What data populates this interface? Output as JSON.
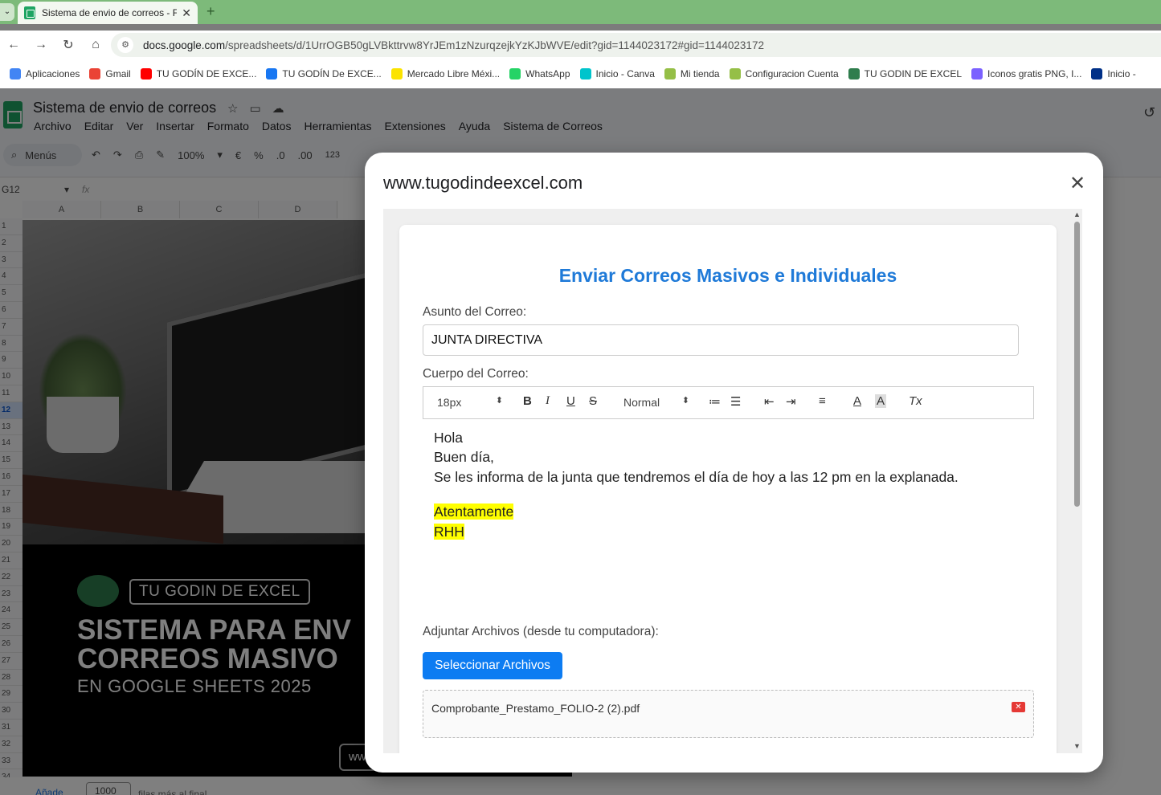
{
  "browser": {
    "tab_title": "Sistema de envio de correos - F",
    "tab_close": "✕",
    "new_tab": "+",
    "url_host": "docs.google.com",
    "url_path": "/spreadsheets/d/1UrrOGB50gLVBkttrvw8YrJEm1zNzurqzejkYzKJbWVE/edit?gid=1144023172#gid=1144023172",
    "bookmarks": [
      {
        "label": "Aplicaciones",
        "color": "#4285f4"
      },
      {
        "label": "Gmail",
        "color": "#ea4335"
      },
      {
        "label": "TU GODÍN DE EXCE...",
        "color": "#ff0000"
      },
      {
        "label": "TU GODÍN De EXCE...",
        "color": "#1877f2"
      },
      {
        "label": "Mercado Libre Méxi...",
        "color": "#fbe300"
      },
      {
        "label": "WhatsApp",
        "color": "#25d366"
      },
      {
        "label": "Inicio - Canva",
        "color": "#00c4cc"
      },
      {
        "label": "Mi tienda",
        "color": "#95bf47"
      },
      {
        "label": "Configuracion Cuenta",
        "color": "#95bf47"
      },
      {
        "label": "TU GODIN DE EXCEL",
        "color": "#2f7d4d"
      },
      {
        "label": "Iconos gratis PNG, I...",
        "color": "#7b61ff"
      },
      {
        "label": "Inicio -",
        "color": "#003087"
      }
    ]
  },
  "sheets": {
    "doc_title": "Sistema de envio de correos",
    "menu": [
      "Archivo",
      "Editar",
      "Ver",
      "Insertar",
      "Formato",
      "Datos",
      "Herramientas",
      "Extensiones",
      "Ayuda",
      "Sistema de Correos"
    ],
    "search_menus": "Menús",
    "zoom": "100%",
    "currency": "€",
    "percent": "%",
    "dec_minus": ".0",
    "dec_plus": ".00",
    "num_format": "123",
    "name_box": "G12",
    "fx": "fx",
    "columns": [
      "A",
      "B",
      "C",
      "D"
    ],
    "rows": [
      "1",
      "2",
      "3",
      "4",
      "5",
      "6",
      "7",
      "8",
      "9",
      "10",
      "11",
      "12",
      "13",
      "14",
      "15",
      "16",
      "17",
      "18",
      "19",
      "20",
      "21",
      "22",
      "23",
      "24",
      "25",
      "26",
      "27",
      "28",
      "29",
      "30",
      "31",
      "32",
      "33",
      "34"
    ],
    "selected_row": "12",
    "add_label": "Añade",
    "rows_value": "1000",
    "rows_more": "filas más al final"
  },
  "banner": {
    "badge": "TU GODIN DE EXCEL",
    "headline_1": "SISTEMA PARA ENV",
    "headline_2": "CORREOS MASIVO",
    "subline": "EN GOOGLE SHEETS 2025",
    "web_button": "ww"
  },
  "dialog": {
    "title": "www.tugodindeexcel.com",
    "close": "✕",
    "heading": "Enviar Correos Masivos e Individuales",
    "subject_label": "Asunto del Correo:",
    "subject_value": "JUNTA DIRECTIVA",
    "body_label": "Cuerpo del Correo:",
    "font_size": "18px",
    "heading_select": "Normal",
    "body_lines": [
      "Hola",
      "Buen día,",
      "Se les informa de la junta que tendremos el día de hoy a las 12 pm en la explanada."
    ],
    "highlighted_lines": [
      "Atentamente",
      "RHH"
    ],
    "highlight_color": "#ffff00",
    "attach_label": "Adjuntar Archivos (desde tu computadora):",
    "select_button": "Seleccionar Archivos",
    "file_name": "Comprobante_Prestamo_FOLIO-2 (2).pdf",
    "accent_color": "#1f7ad8",
    "button_color": "#0d7cf2"
  }
}
